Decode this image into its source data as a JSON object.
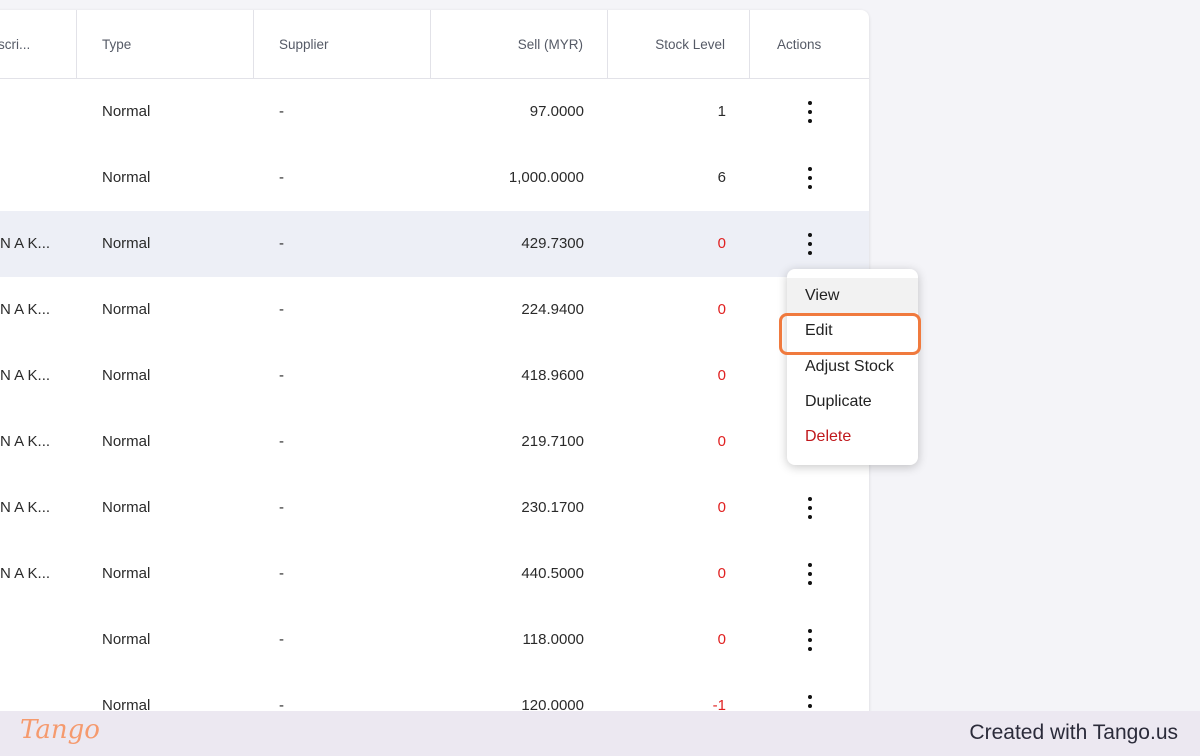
{
  "table": {
    "columns": {
      "description": "scri...",
      "type": "Type",
      "supplier": "Supplier",
      "sell": "Sell (MYR)",
      "stock": "Stock Level",
      "actions": "Actions"
    },
    "rows": [
      {
        "desc": "",
        "type": "Normal",
        "supplier": "-",
        "sell": "97.0000",
        "stock": "1"
      },
      {
        "desc": "",
        "type": "Normal",
        "supplier": "-",
        "sell": "1,000.0000",
        "stock": "6"
      },
      {
        "desc": "N A K...",
        "type": "Normal",
        "supplier": "-",
        "sell": "429.7300",
        "stock": "0"
      },
      {
        "desc": "N A K...",
        "type": "Normal",
        "supplier": "-",
        "sell": "224.9400",
        "stock": "0"
      },
      {
        "desc": "N A K...",
        "type": "Normal",
        "supplier": "-",
        "sell": "418.9600",
        "stock": "0"
      },
      {
        "desc": "N A K...",
        "type": "Normal",
        "supplier": "-",
        "sell": "219.7100",
        "stock": "0"
      },
      {
        "desc": "N A K...",
        "type": "Normal",
        "supplier": "-",
        "sell": "230.1700",
        "stock": "0"
      },
      {
        "desc": "N A K...",
        "type": "Normal",
        "supplier": "-",
        "sell": "440.5000",
        "stock": "0"
      },
      {
        "desc": "",
        "type": "Normal",
        "supplier": "-",
        "sell": "118.0000",
        "stock": "0"
      },
      {
        "desc": "",
        "type": "Normal",
        "supplier": "-",
        "sell": "120.0000",
        "stock": "-1"
      }
    ]
  },
  "context_menu": {
    "items": [
      "View",
      "Edit",
      "Adjust Stock",
      "Duplicate",
      "Delete"
    ]
  },
  "footer": {
    "logo": "Tango",
    "created_text": "Created with Tango.us"
  },
  "colors": {
    "highlight_row": "#edeff6",
    "negative_stock": "#e02020",
    "delete": "#c0181c",
    "focus_ring": "#f07a3e"
  }
}
